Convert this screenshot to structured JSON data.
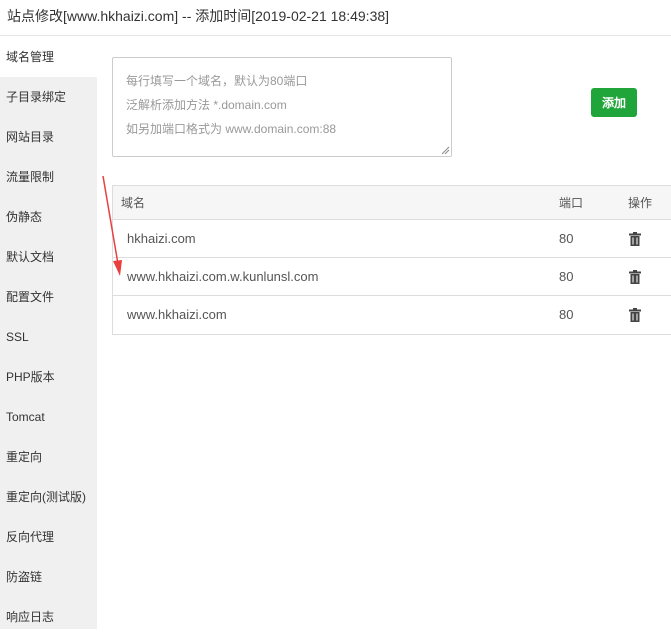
{
  "window": {
    "title": "站点修改[www.hkhaizi.com] -- 添加时间[2019-02-21 18:49:38]"
  },
  "sidebar": {
    "items": [
      {
        "label": "域名管理",
        "active": true
      },
      {
        "label": "子目录绑定"
      },
      {
        "label": "网站目录"
      },
      {
        "label": "流量限制"
      },
      {
        "label": "伪静态"
      },
      {
        "label": "默认文档"
      },
      {
        "label": "配置文件"
      },
      {
        "label": "SSL"
      },
      {
        "label": "PHP版本"
      },
      {
        "label": "Tomcat"
      },
      {
        "label": "重定向"
      },
      {
        "label": "重定向(测试版)"
      },
      {
        "label": "反向代理"
      },
      {
        "label": "防盗链"
      },
      {
        "label": "响应日志"
      }
    ]
  },
  "domain_input": {
    "placeholder_lines": [
      "每行填写一个域名，默认为80端口",
      "泛解析添加方法 *.domain.com",
      "如另加端口格式为 www.domain.com:88"
    ]
  },
  "add_button": {
    "label": "添加",
    "color": "#20a53a"
  },
  "table": {
    "headers": {
      "name": "域名",
      "port": "端口",
      "op": "操作"
    },
    "rows": [
      {
        "name": "hkhaizi.com",
        "port": "80",
        "icon": "trash-icon"
      },
      {
        "name": "www.hkhaizi.com.w.kunlunsl.com",
        "port": "80",
        "icon": "trash-icon"
      },
      {
        "name": "www.hkhaizi.com",
        "port": "80",
        "icon": "trash-icon"
      }
    ]
  },
  "annotation": {
    "color": "#e8403f"
  }
}
